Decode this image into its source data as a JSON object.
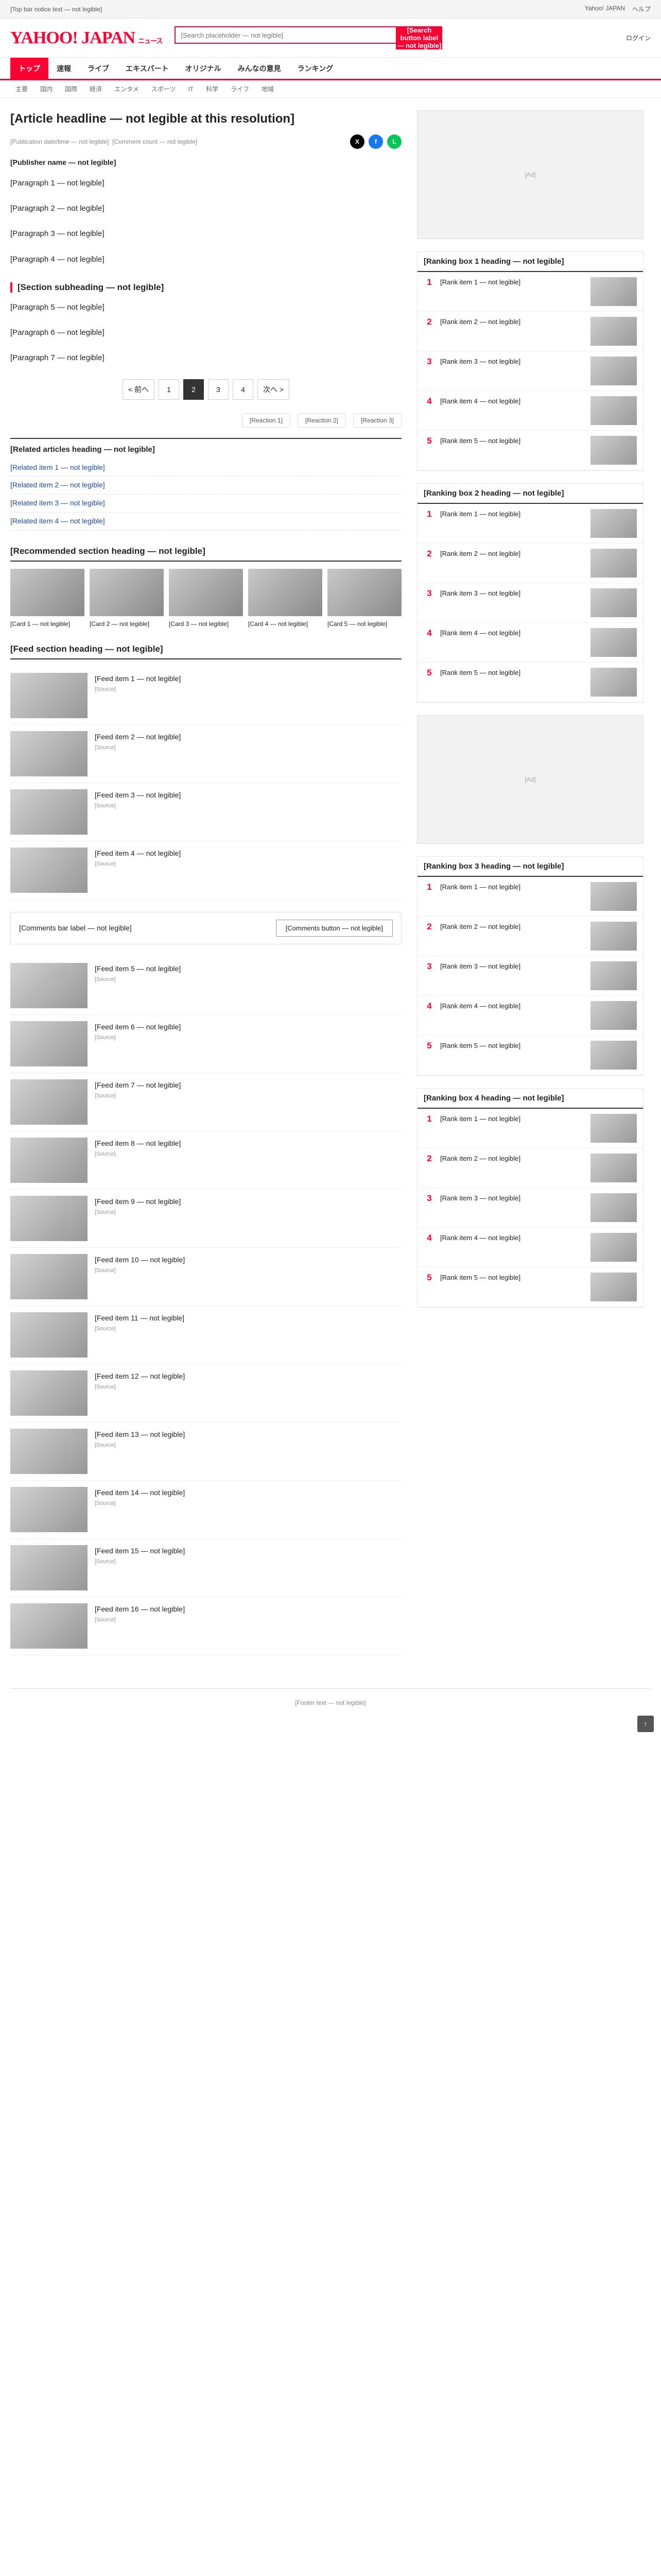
{
  "topbar": {
    "notice": "[Top bar notice text — not legible]",
    "links": [
      "Yahoo! JAPAN",
      "ヘルプ"
    ]
  },
  "header": {
    "logo": "YAHOO! JAPAN",
    "service": "ニュース",
    "search_placeholder": "[Search placeholder — not legible]",
    "search_button": "[Search button label — not legible]",
    "right_links": [
      "ログイン"
    ]
  },
  "nav": {
    "items": [
      "トップ",
      "速報",
      "ライブ",
      "エキスパート",
      "オリジナル",
      "みんなの意見",
      "ランキング"
    ],
    "active_index": 0
  },
  "subnav": {
    "items": [
      "主要",
      "国内",
      "国際",
      "経済",
      "エンタメ",
      "スポーツ",
      "IT",
      "科学",
      "ライフ",
      "地域"
    ]
  },
  "article": {
    "headline": "[Article headline — not legible at this resolution]",
    "date": "[Publication date/time — not legible]",
    "comment_count": "[Comment count — not legible]",
    "source": "[Publisher name — not legible]",
    "share_labels": [
      "X",
      "f",
      "L"
    ],
    "paragraphs": [
      "[Paragraph 1 — not legible]",
      "[Paragraph 2 — not legible]",
      "[Paragraph 3 — not legible]",
      "[Paragraph 4 — not legible]"
    ],
    "subheading": "[Section subheading — not legible]",
    "paragraphs_2": [
      "[Paragraph 5 — not legible]",
      "[Paragraph 6 — not legible]",
      "[Paragraph 7 — not legible]"
    ],
    "pager": {
      "prev": "< 前へ",
      "pages": [
        "1",
        "2",
        "3",
        "4"
      ],
      "current": "2",
      "next": "次へ >"
    },
    "reactions": [
      "[Reaction 1]",
      "[Reaction 2]",
      "[Reaction 3]"
    ]
  },
  "related": {
    "title": "[Related articles heading — not legible]",
    "items": [
      "[Related item 1 — not legible]",
      "[Related item 2 — not legible]",
      "[Related item 3 — not legible]",
      "[Related item 4 — not legible]"
    ]
  },
  "recommended": {
    "title": "[Recommended section heading — not legible]",
    "cards": [
      "[Card 1 — not legible]",
      "[Card 2 — not legible]",
      "[Card 3 — not legible]",
      "[Card 4 — not legible]",
      "[Card 5 — not legible]"
    ]
  },
  "feed": {
    "title": "[Feed section heading — not legible]",
    "rows": [
      {
        "title": "[Feed item 1 — not legible]",
        "src": "[Source]"
      },
      {
        "title": "[Feed item 2 — not legible]",
        "src": "[Source]"
      },
      {
        "title": "[Feed item 3 — not legible]",
        "src": "[Source]"
      },
      {
        "title": "[Feed item 4 — not legible]",
        "src": "[Source]"
      }
    ]
  },
  "comments": {
    "label": "[Comments bar label — not legible]",
    "button": "[Comments button — not legible]"
  },
  "more_feed": {
    "rows": [
      {
        "title": "[Feed item 5 — not legible]",
        "src": "[Source]"
      },
      {
        "title": "[Feed item 6 — not legible]",
        "src": "[Source]"
      },
      {
        "title": "[Feed item 7 — not legible]",
        "src": "[Source]"
      },
      {
        "title": "[Feed item 8 — not legible]",
        "src": "[Source]"
      },
      {
        "title": "[Feed item 9 — not legible]",
        "src": "[Source]"
      },
      {
        "title": "[Feed item 10 — not legible]",
        "src": "[Source]"
      },
      {
        "title": "[Feed item 11 — not legible]",
        "src": "[Source]"
      },
      {
        "title": "[Feed item 12 — not legible]",
        "src": "[Source]"
      },
      {
        "title": "[Feed item 13 — not legible]",
        "src": "[Source]"
      },
      {
        "title": "[Feed item 14 — not legible]",
        "src": "[Source]"
      },
      {
        "title": "[Feed item 15 — not legible]",
        "src": "[Source]"
      },
      {
        "title": "[Feed item 16 — not legible]",
        "src": "[Source]"
      }
    ]
  },
  "side": {
    "ad_label": "[Ad]",
    "ranking_title": "[Ranking box 1 heading — not legible]",
    "ranking": [
      "[Rank item 1 — not legible]",
      "[Rank item 2 — not legible]",
      "[Rank item 3 — not legible]",
      "[Rank item 4 — not legible]",
      "[Rank item 5 — not legible]"
    ],
    "ranking2_title": "[Ranking box 2 heading — not legible]",
    "ranking2": [
      "[Rank item 1 — not legible]",
      "[Rank item 2 — not legible]",
      "[Rank item 3 — not legible]",
      "[Rank item 4 — not legible]",
      "[Rank item 5 — not legible]"
    ],
    "ranking3_title": "[Ranking box 3 heading — not legible]",
    "ranking3": [
      "[Rank item 1 — not legible]",
      "[Rank item 2 — not legible]",
      "[Rank item 3 — not legible]",
      "[Rank item 4 — not legible]",
      "[Rank item 5 — not legible]"
    ],
    "ranking4_title": "[Ranking box 4 heading — not legible]",
    "ranking4": [
      "[Rank item 1 — not legible]",
      "[Rank item 2 — not legible]",
      "[Rank item 3 — not legible]",
      "[Rank item 4 — not legible]",
      "[Rank item 5 — not legible]"
    ]
  },
  "footer": {
    "copyright": "[Footer text — not legible]"
  },
  "pagetop": "↑"
}
